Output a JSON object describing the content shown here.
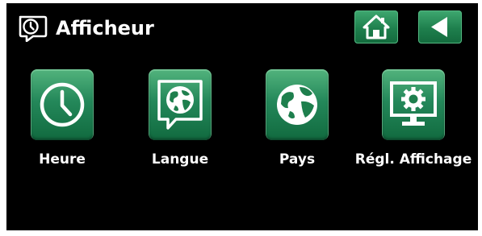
{
  "header": {
    "title": "Afficheur",
    "title_icon": "clock-speech-bubble-icon"
  },
  "nav": {
    "home_icon": "home-icon",
    "back_icon": "back-arrow-icon"
  },
  "tiles": [
    {
      "label": "Heure",
      "icon": "clock-icon"
    },
    {
      "label": "Langue",
      "icon": "globe-speech-bubble-icon"
    },
    {
      "label": "Pays",
      "icon": "globe-icon"
    },
    {
      "label": "Régl. Affichage",
      "icon": "monitor-gear-icon"
    }
  ],
  "colors": {
    "background": "#000000",
    "button_green": "#1e7f4d",
    "text": "#ffffff"
  }
}
